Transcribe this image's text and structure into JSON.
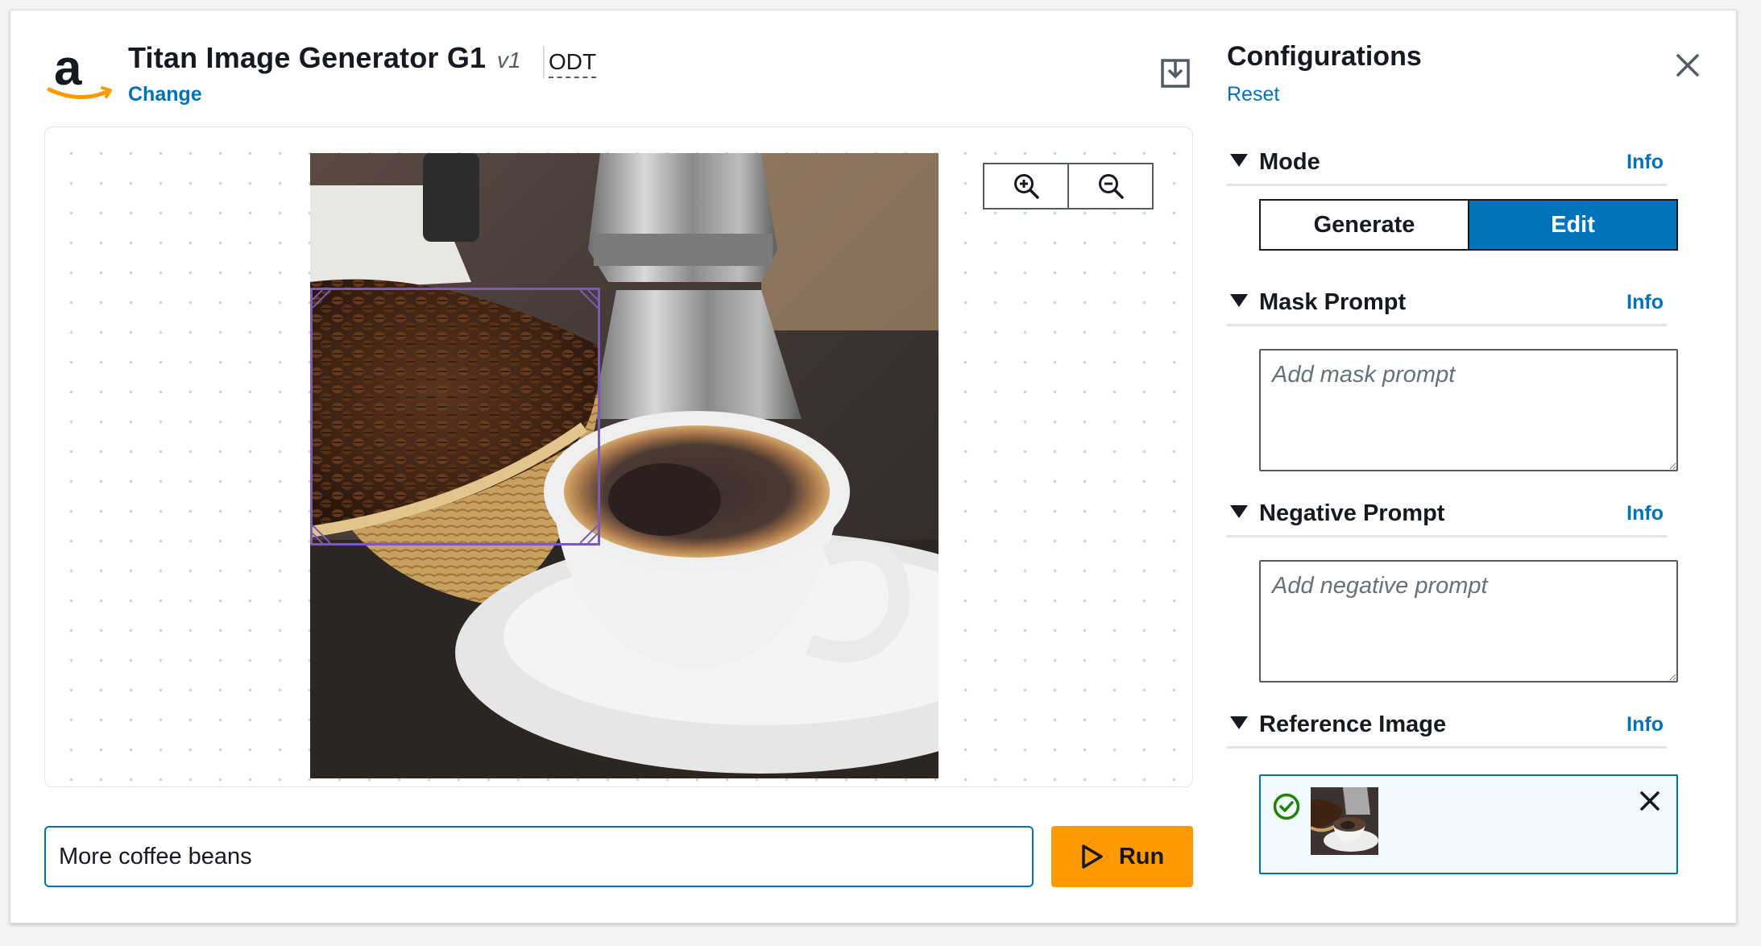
{
  "header": {
    "model_name": "Titan Image Generator G1",
    "model_version": "v1",
    "model_variant": "ODT",
    "change_label": "Change"
  },
  "prompt": {
    "value": "More coffee beans",
    "run_label": "Run"
  },
  "sidebar": {
    "title": "Configurations",
    "reset_label": "Reset",
    "sections": [
      {
        "label": "Mode",
        "info": "Info"
      },
      {
        "label": "Mask Prompt",
        "info": "Info"
      },
      {
        "label": "Negative Prompt",
        "info": "Info"
      },
      {
        "label": "Reference Image",
        "info": "Info"
      }
    ],
    "mode": {
      "options": [
        "Generate",
        "Edit"
      ],
      "selected": "Edit"
    },
    "mask_prompt": {
      "placeholder": "Add mask prompt",
      "value": ""
    },
    "negative_prompt": {
      "placeholder": "Add negative prompt",
      "value": ""
    }
  },
  "icons": {
    "logo": "amazon-logo-icon",
    "download": "download-icon",
    "zoom_in": "zoom-in-icon",
    "zoom_out": "zoom-out-icon",
    "run": "play-icon",
    "close": "close-icon",
    "reference_status": "check-circle-icon",
    "reference_remove": "close-icon"
  },
  "colors": {
    "accent": "#0073bb",
    "run_button": "#ff9900",
    "mask_box": "#7b5bb5",
    "success": "#1d8102",
    "reference_bg": "#f1faff"
  }
}
